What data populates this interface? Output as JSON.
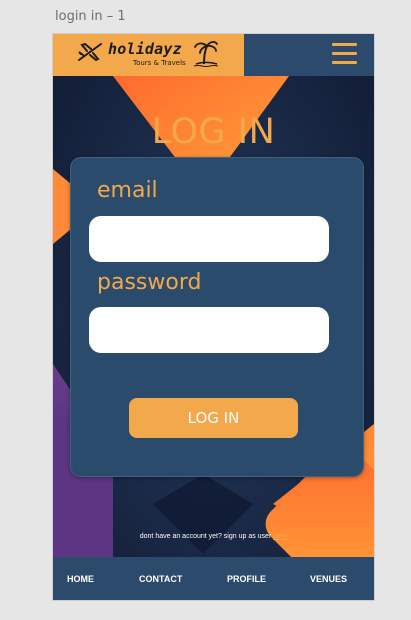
{
  "artboard": {
    "label": "login in – 1"
  },
  "header": {
    "brand_name": "holidayz",
    "brand_tagline": "Tours & Travels",
    "logo_icons": [
      "plane-icon",
      "palm-tree-icon"
    ],
    "menu_icon": "hamburger-menu-icon"
  },
  "main": {
    "title": "LOG IN",
    "form": {
      "email_label": "email",
      "email_value": "",
      "password_label": "password",
      "password_value": "",
      "submit_label": "LOG IN"
    },
    "signup": {
      "text": "dont have an account yet? sign up as user ",
      "link_text": "here"
    }
  },
  "nav": {
    "items": [
      {
        "label": "HOME"
      },
      {
        "label": "CONTACT"
      },
      {
        "label": "PROFILE"
      },
      {
        "label": "VENUES"
      }
    ]
  },
  "colors": {
    "accent": "#f2a84b",
    "header_bg": "#2c4a6b",
    "card_bg": "#2b4b6d",
    "page_bg": "#1b2a47",
    "artboard_bg": "#e6e6e6"
  }
}
